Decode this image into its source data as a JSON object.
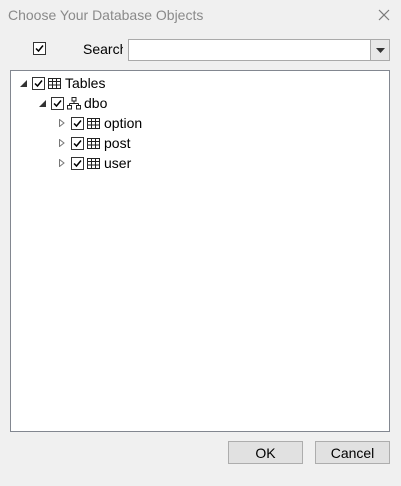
{
  "window": {
    "title": "Choose Your Database Objects"
  },
  "search": {
    "label": "Search",
    "value": "",
    "placeholder": ""
  },
  "tree": {
    "root": {
      "label": "Tables",
      "checked": true,
      "expanded": true
    },
    "schema": {
      "label": "dbo",
      "checked": true,
      "expanded": true
    },
    "tables": [
      {
        "label": "option",
        "checked": true,
        "expanded": false
      },
      {
        "label": "post",
        "checked": true,
        "expanded": false
      },
      {
        "label": "user",
        "checked": true,
        "expanded": false
      }
    ]
  },
  "buttons": {
    "ok": "OK",
    "cancel": "Cancel"
  }
}
